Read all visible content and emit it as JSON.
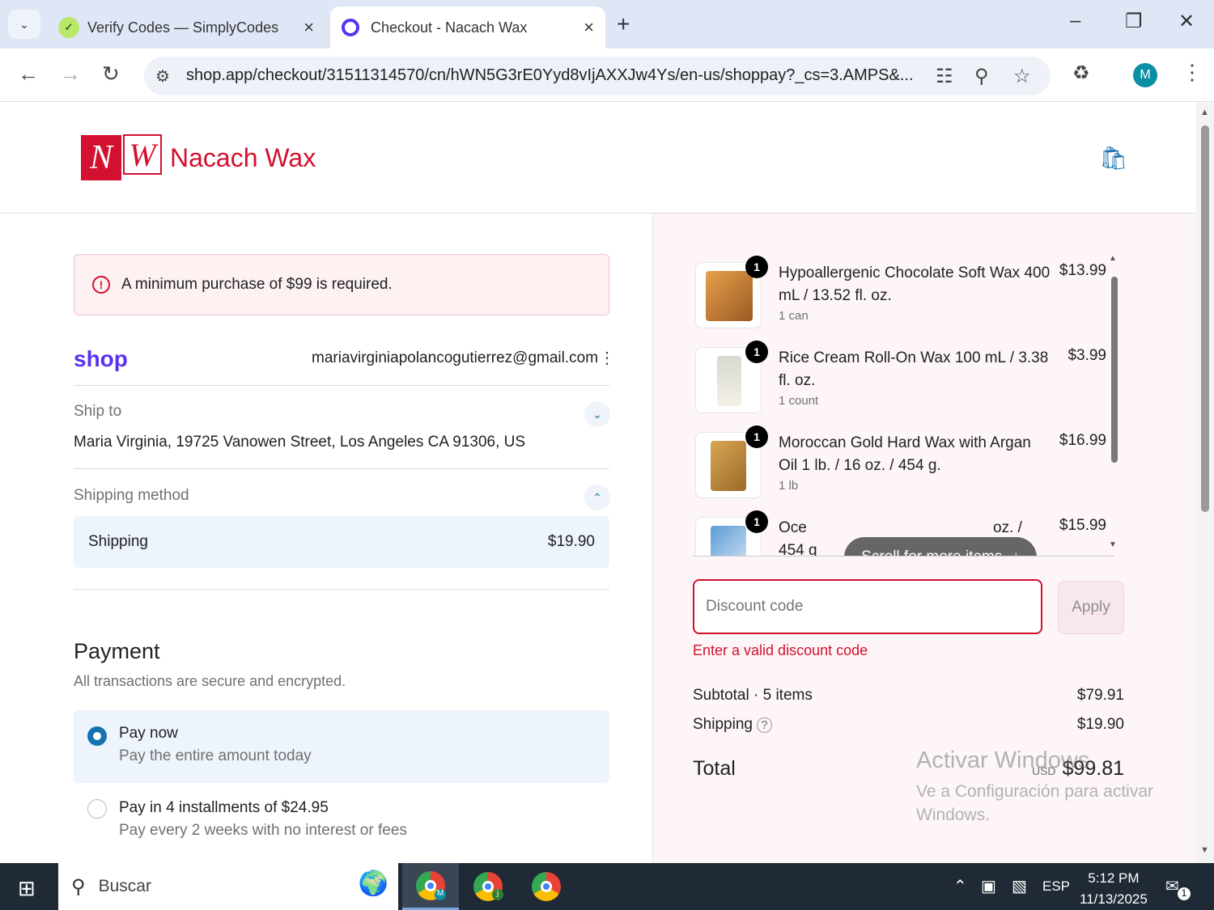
{
  "browser": {
    "tabs": [
      {
        "title": "Verify Codes — SimplyCodes",
        "active": false
      },
      {
        "title": "Checkout - Nacach Wax",
        "active": true
      }
    ],
    "url": "shop.app/checkout/31511314570/cn/hWN5G3rE0Yyd8vIjAXXJw4Ys/en-us/shoppay?_cs=3.AMPS&...",
    "profile_initial": "M"
  },
  "store": {
    "logo_n": "N",
    "logo_w": "W",
    "name": "Nacach Wax"
  },
  "alert": {
    "message": "A minimum purchase of $99 is required."
  },
  "account": {
    "shop_label": "shop",
    "email": "mariavirginiapolancogutierrez@gmail.com"
  },
  "ship_to": {
    "label": "Ship to",
    "address": "Maria Virginia, 19725 Vanowen Street, Los Angeles CA 91306, US"
  },
  "shipping_method": {
    "label": "Shipping method",
    "option_name": "Shipping",
    "option_price": "$19.90"
  },
  "payment": {
    "title": "Payment",
    "subtitle": "All transactions are secure and encrypted.",
    "options": [
      {
        "title": "Pay now",
        "subtitle": "Pay the entire amount today",
        "selected": true
      },
      {
        "title": "Pay in 4 installments of $24.95",
        "subtitle": "Pay every 2 weeks with no interest or fees",
        "selected": false
      }
    ]
  },
  "cart": {
    "items": [
      {
        "qty": "1",
        "name": "Hypoallergenic Chocolate Soft Wax 400 mL / 13.52 fl. oz.",
        "variant": "1 can",
        "price": "$13.99"
      },
      {
        "qty": "1",
        "name": "Rice Cream Roll-On Wax 100 mL / 3.38 fl. oz.",
        "variant": "1 count",
        "price": "$3.99"
      },
      {
        "qty": "1",
        "name": "Moroccan Gold Hard Wax with Argan Oil 1 lb. / 16 oz. / 454 g.",
        "variant": "1 lb",
        "price": "$16.99"
      },
      {
        "qty": "1",
        "name_start": "Oce",
        "name_end": "oz. /",
        "name_line2": "454 g",
        "price": "$15.99"
      }
    ],
    "scroll_hint": "Scroll for more items",
    "discount_placeholder": "Discount code",
    "apply_label": "Apply",
    "discount_error": "Enter a valid discount code"
  },
  "summary": {
    "subtotal_label": "Subtotal · 5 items",
    "subtotal_value": "$79.91",
    "shipping_label": "Shipping",
    "shipping_value": "$19.90",
    "total_label": "Total",
    "currency": "USD",
    "total_value": "$99.81"
  },
  "watermark": {
    "title": "Activar Windows",
    "subtitle": "Ve a Configuración para activar Windows."
  },
  "taskbar": {
    "search_label": "Buscar",
    "language": "ESP",
    "time": "5:12 PM",
    "date": "11/13/2025",
    "notification_count": "1",
    "app_badges": [
      "M",
      "j"
    ]
  },
  "colors": {
    "accent": "#1773b0",
    "brand_red": "#d3102f",
    "shop_purple": "#5a31f4",
    "summary_bg": "#fdf5f7"
  }
}
